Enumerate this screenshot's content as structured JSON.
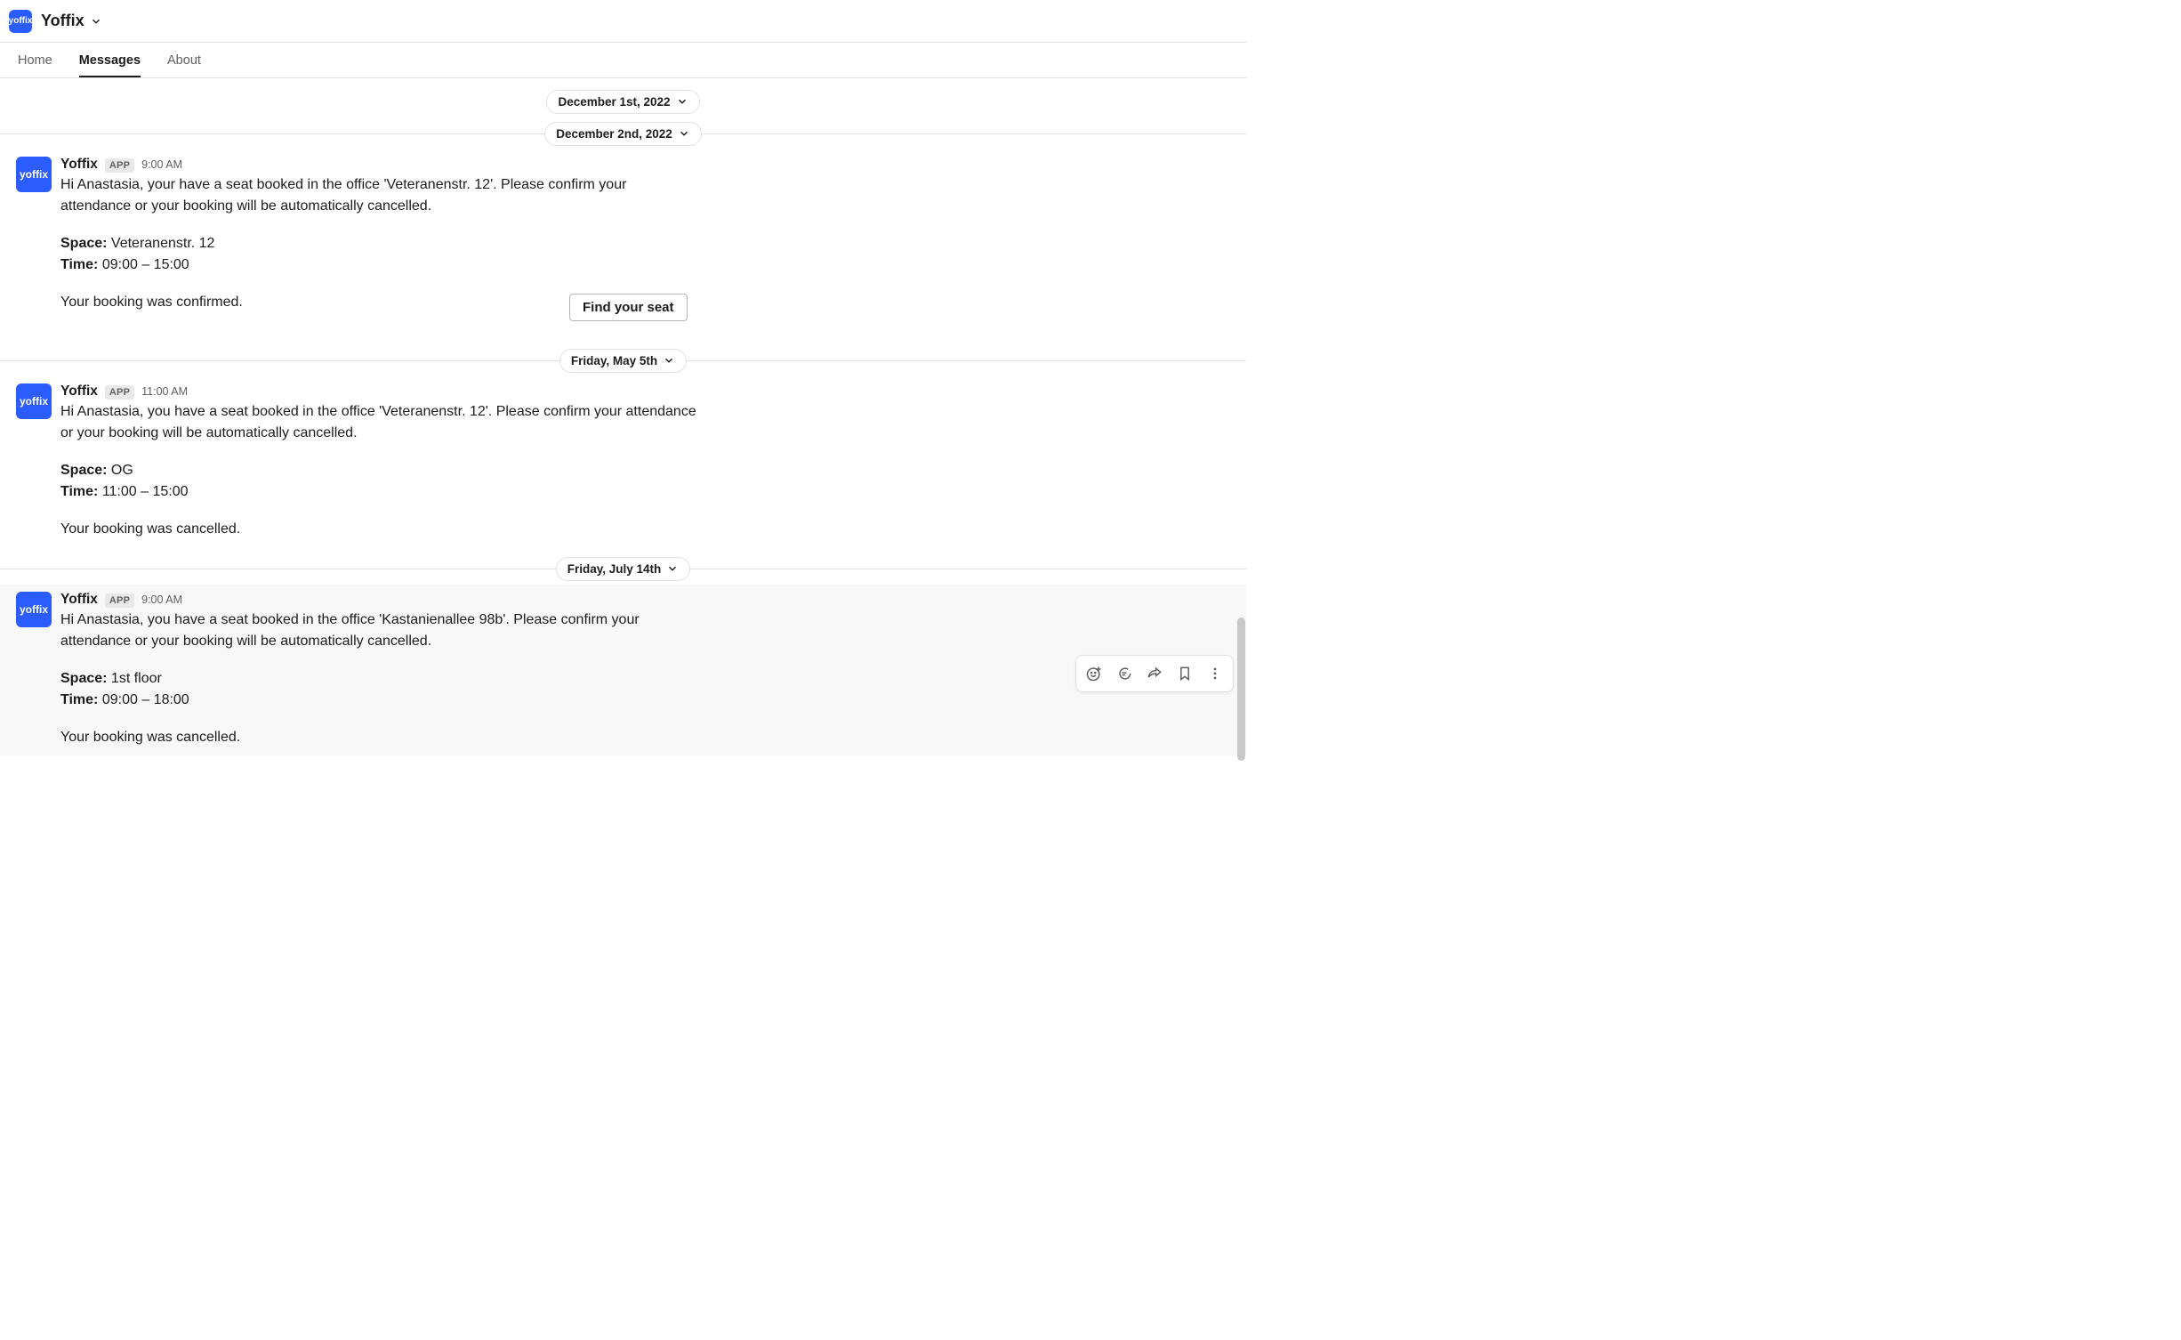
{
  "header": {
    "logo_text": "yoffix",
    "title": "Yoffix"
  },
  "tabs": [
    {
      "label": "Home",
      "active": false
    },
    {
      "label": "Messages",
      "active": true
    },
    {
      "label": "About",
      "active": false
    }
  ],
  "cut_text": "Your booking was cancelled.",
  "dividers": {
    "d1": "December 1st, 2022",
    "d2": "December 2nd, 2022",
    "d3": "Friday, May 5th",
    "d4": "Friday, July 14th"
  },
  "sender": {
    "name": "Yoffix",
    "badge": "APP",
    "avatar_text": "yoffix"
  },
  "messages": [
    {
      "time": "9:00 AM",
      "greeting": "Hi Anastasia, your have a seat booked in the office 'Veteranenstr. 12'. Please confirm your attendance or your booking will be automatically cancelled.",
      "space_label": "Space:",
      "space_value": " Veteranenstr. 12",
      "time_label": "Time:",
      "time_value": " 09:00 – 15:00",
      "status": "Your booking was confirmed.",
      "button": "Find your seat"
    },
    {
      "time": "11:00 AM",
      "greeting": "Hi Anastasia, you have a seat booked in the office 'Veteranenstr. 12'. Please confirm your attendance or your booking will be automatically cancelled.",
      "space_label": "Space:",
      "space_value": " OG",
      "time_label": "Time:",
      "time_value": " 11:00 – 15:00",
      "status": "Your booking was cancelled."
    },
    {
      "time": "9:00 AM",
      "greeting": "Hi Anastasia, you have a seat booked in the office 'Kastanienallee 98b'. Please confirm your attendance or your booking will be automatically cancelled.",
      "space_label": "Space:",
      "space_value": " 1st floor",
      "time_label": "Time:",
      "time_value": " 09:00 – 18:00",
      "status": "Your booking was cancelled."
    }
  ]
}
